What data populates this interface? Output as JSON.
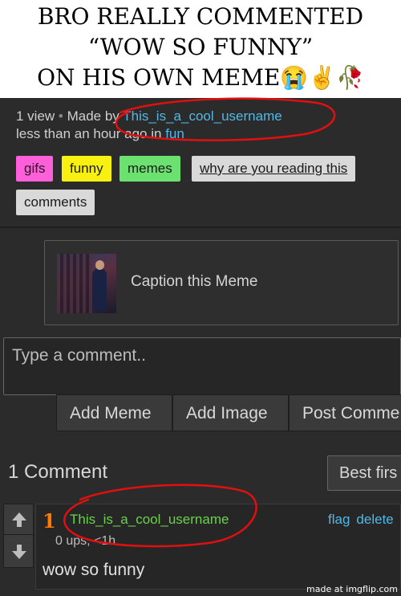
{
  "caption": {
    "line1": "BRO REALLY COMMENTED",
    "line2": "“WOW SO FUNNY”",
    "line3": "ON HIS OWN MEME😭✌️🥀"
  },
  "post_meta": {
    "views": "1 view",
    "separator": "•",
    "made_by_label": "Made by",
    "username": "This_is_a_cool_username",
    "time_text": "less than an hour ago in",
    "stream": "fun"
  },
  "tags": [
    "gifs",
    "funny",
    "memes",
    "why are you reading this",
    "comments"
  ],
  "caption_meme": {
    "label": "Caption this Meme"
  },
  "comment_input": {
    "placeholder": "Type a comment.."
  },
  "buttons": {
    "add_meme": "Add Meme",
    "add_image": "Add Image",
    "post_comment": "Post Comme"
  },
  "comments_header": {
    "count": "1 Comment",
    "sort": "Best firs"
  },
  "comment": {
    "rank": "1",
    "username": "This_is_a_cool_username",
    "flag": "flag",
    "delete": "delete",
    "ups": "0 ups, <1h",
    "text": "wow so funny"
  },
  "watermark": "made at imgflip.com",
  "colors": {
    "link": "#4fb8e8",
    "username_green": "#6ad24a",
    "annotation_red": "#e01010"
  }
}
